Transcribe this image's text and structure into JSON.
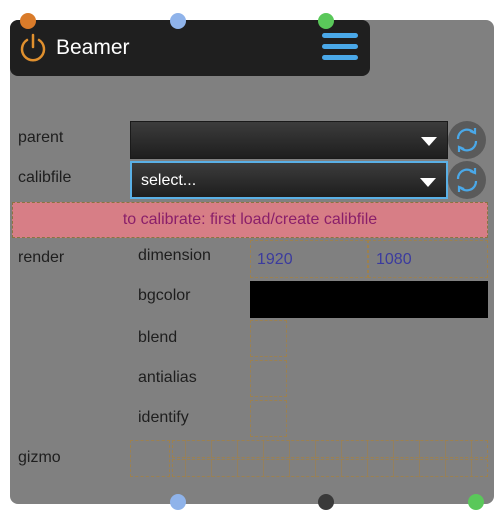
{
  "node": {
    "title": "Beamer"
  },
  "fields": {
    "parent": {
      "label": "parent",
      "value": ""
    },
    "calibfile": {
      "label": "calibfile",
      "value": "select..."
    }
  },
  "info_message": "to calibrate: first load/create calibfile",
  "render": {
    "label": "render",
    "dimension_label": "dimension",
    "width": "1920",
    "height": "1080",
    "bgcolor_label": "bgcolor",
    "bgcolor": "#000000",
    "blend_label": "blend",
    "antialias_label": "antialias",
    "identify_label": "identify"
  },
  "gizmo": {
    "label": "gizmo"
  },
  "colors": {
    "accent": "#4aa8e8",
    "power": "#e0902e",
    "info_bg": "#d77e86",
    "info_text": "#8a1f6a",
    "port_orange": "#d97b2a",
    "port_blue": "#8fb3ea",
    "port_green": "#5ac85a",
    "port_dark": "#3a3a3a"
  },
  "icons": {
    "power": "power-icon",
    "menu": "hamburger-menu-icon",
    "refresh": "refresh-icon",
    "dropdown": "chevron-down-icon"
  }
}
